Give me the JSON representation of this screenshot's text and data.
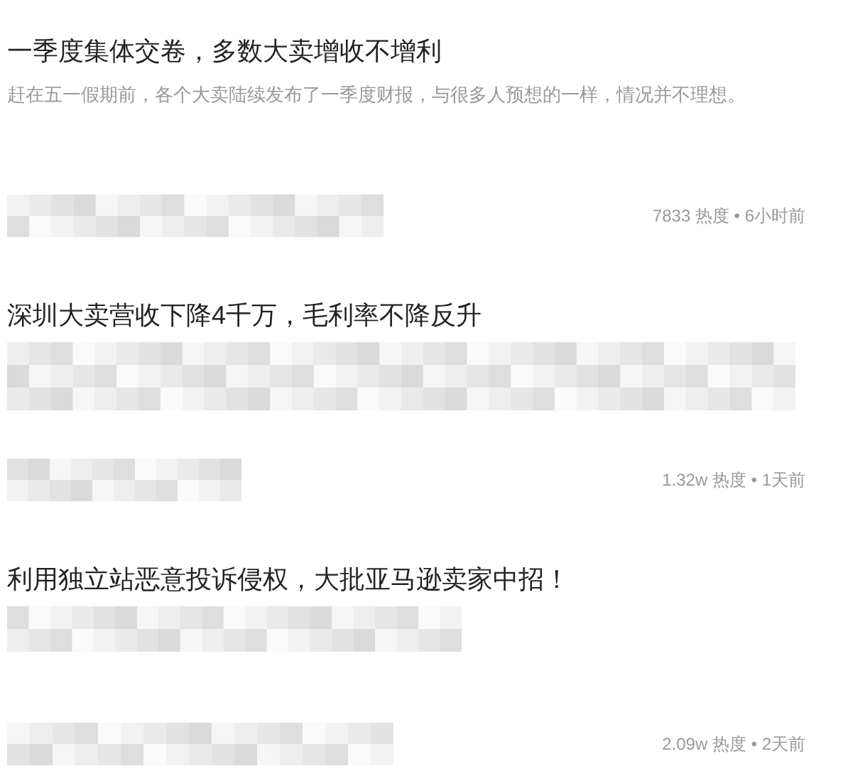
{
  "articles": [
    {
      "title": "一季度集体交卷，多数大卖增收不增利",
      "summary": "赶在五一假期前，各个大卖陆续发布了一季度财报，与很多人预想的一样，情况并不理想。",
      "meta": "7833 热度 • 6小时前"
    },
    {
      "title": "深圳大卖营收下降4千万，毛利率不降反升",
      "meta": "1.32w 热度 • 1天前"
    },
    {
      "title": "利用独立站恶意投诉侵权，大批亚马逊卖家中招！",
      "meta": "2.09w 热度 • 2天前"
    }
  ]
}
